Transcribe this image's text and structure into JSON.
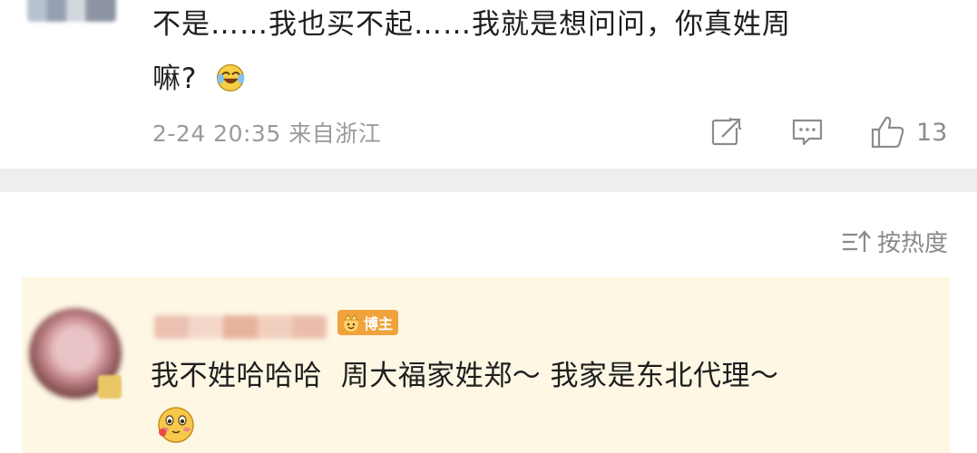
{
  "comment_top": {
    "text": "不是……我也买不起……我就是想问问，你真姓周嘛?",
    "line1": "不是……我也买不起……我就是想问问，你真姓周",
    "line2": "嘛?",
    "emoji": "laughing-crying-emoji",
    "time": "2-24 20:35",
    "source": "来自浙江",
    "actions": {
      "forward_icon": "share-icon",
      "comment_icon": "comment-icon",
      "like_icon": "thumbs-up-icon",
      "like_count": "13"
    }
  },
  "sort": {
    "icon": "sort-icon",
    "label": "按热度"
  },
  "comment_blogger": {
    "badge": "博主",
    "text": "我不姓哈哈哈  周大福家姓郑～ 我家是东北代理～",
    "emoji": "shy-blush-emoji"
  },
  "colors": {
    "highlight_bg": "#fdf7e4",
    "separator": "#eeeeee",
    "badge_bg": "#f0a33c",
    "meta_gray": "#9a9a9a"
  }
}
